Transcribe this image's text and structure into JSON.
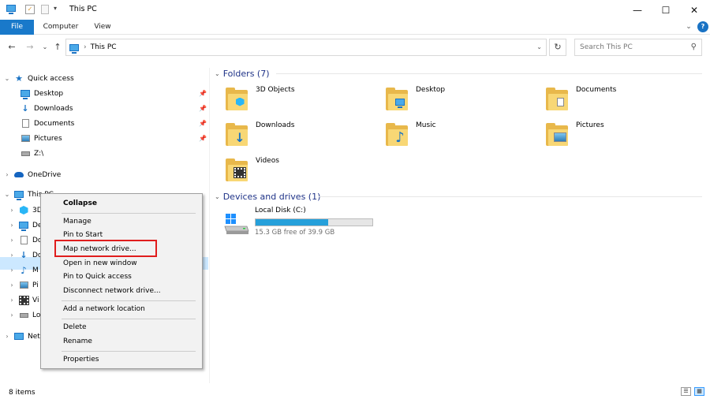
{
  "window": {
    "title": "This PC",
    "controls": {
      "minimize": "—",
      "maximize": "☐",
      "close": "✕"
    }
  },
  "ribbon": {
    "tabs": [
      {
        "label": "File"
      },
      {
        "label": "Computer"
      },
      {
        "label": "View"
      }
    ]
  },
  "address": {
    "crumb": "This PC",
    "search_placeholder": "Search This PC"
  },
  "nav": {
    "quick_access": "Quick access",
    "quick_items": [
      {
        "label": "Desktop"
      },
      {
        "label": "Downloads"
      },
      {
        "label": "Documents"
      },
      {
        "label": "Pictures"
      },
      {
        "label": "Z:\\"
      }
    ],
    "onedrive": "OneDrive",
    "this_pc": "This PC",
    "sub_items": [
      "3D",
      "De",
      "Do",
      "Do",
      "M",
      "Pi",
      "Vi",
      "Lo"
    ],
    "network": "Net"
  },
  "content": {
    "folders_header": "Folders (7)",
    "folders": [
      {
        "label": "3D Objects"
      },
      {
        "label": "Desktop"
      },
      {
        "label": "Documents"
      },
      {
        "label": "Downloads"
      },
      {
        "label": "Music"
      },
      {
        "label": "Pictures"
      },
      {
        "label": "Videos"
      }
    ],
    "drives_header": "Devices and drives (1)",
    "drive": {
      "name": "Local Disk (C:)",
      "free_text": "15.3 GB free of 39.9 GB",
      "used_fraction": 0.62
    }
  },
  "context_menu": {
    "items": [
      "Collapse",
      "Manage",
      "Pin to Start",
      "Map network drive...",
      "Open in new window",
      "Pin to Quick access",
      "Disconnect network drive...",
      "Add a network location",
      "Delete",
      "Rename",
      "Properties"
    ]
  },
  "status": {
    "items": "8 items"
  },
  "colors": {
    "accent": "#1979ca",
    "selection": "#cce8ff",
    "highlight_box": "#e01d1d",
    "drive_bar": "#26a0da"
  }
}
